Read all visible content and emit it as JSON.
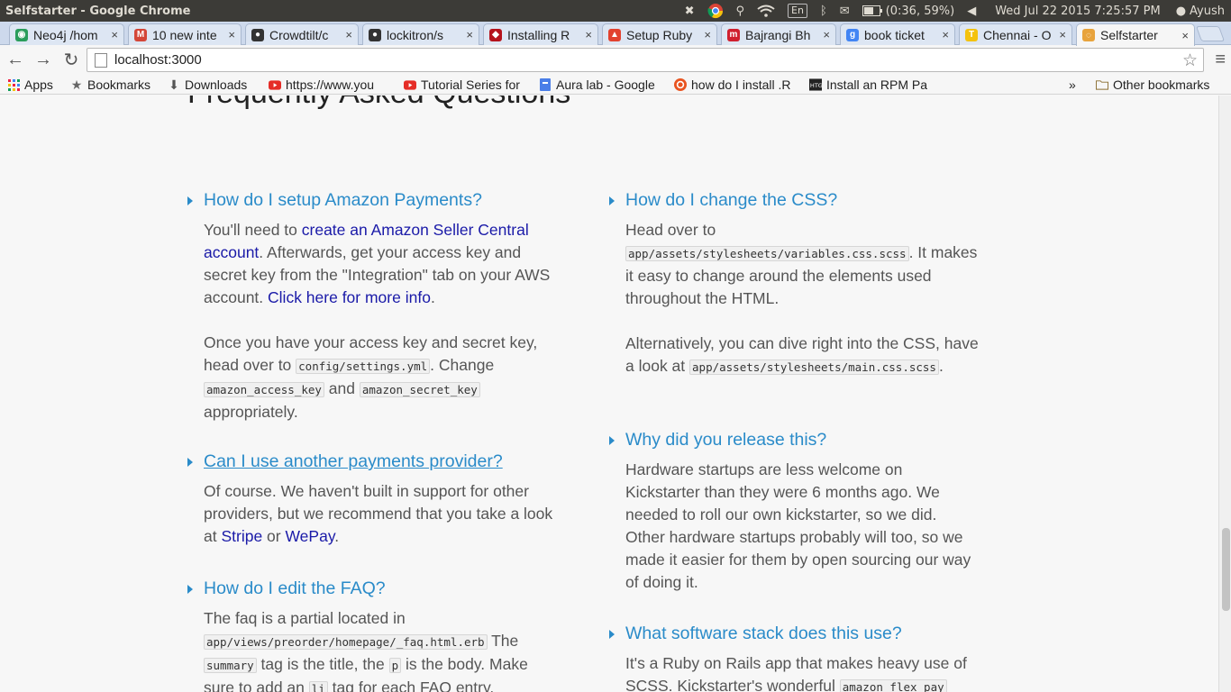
{
  "window": {
    "title": "Selfstarter - Google Chrome"
  },
  "os_panel": {
    "language": "En",
    "battery": "(0:36, 59%)",
    "datetime": "Wed Jul 22 2015  7:25:57 PM",
    "user": "Ayush"
  },
  "tabs": [
    {
      "label": "Neo4j /hom",
      "fav_color": "#2a9d5b",
      "fav_glyph": "◉"
    },
    {
      "label": "10 new inte",
      "fav_color": "#d44638",
      "fav_glyph": "M"
    },
    {
      "label": "Crowdtilt/c",
      "fav_color": "#333333",
      "fav_glyph": "●"
    },
    {
      "label": "lockitron/s",
      "fav_color": "#333333",
      "fav_glyph": "●"
    },
    {
      "label": "Installing R",
      "fav_color": "#b5121b",
      "fav_glyph": "◆"
    },
    {
      "label": "Setup Ruby",
      "fav_color": "#e2422f",
      "fav_glyph": "▲"
    },
    {
      "label": "Bajrangi Bh",
      "fav_color": "#d01f2e",
      "fav_glyph": "m"
    },
    {
      "label": "book ticket",
      "fav_color": "#4285f4",
      "fav_glyph": "g"
    },
    {
      "label": "Chennai - O",
      "fav_color": "#f4c20d",
      "fav_glyph": "T"
    },
    {
      "label": "Selfstarter",
      "fav_color": "#e8a33c",
      "fav_glyph": "◌"
    }
  ],
  "address_bar": {
    "url": "localhost:3000"
  },
  "bookmarks": [
    {
      "label": "Apps",
      "icon": "apps-grid-icon"
    },
    {
      "label": "Bookmarks",
      "icon": "star-icon"
    },
    {
      "label": "Downloads",
      "icon": "download-icon"
    },
    {
      "label": "https://www.you",
      "icon": "youtube-icon"
    },
    {
      "label": "Tutorial Series for",
      "icon": "youtube-icon"
    },
    {
      "label": "Aura lab - Google",
      "icon": "google-sites-icon"
    },
    {
      "label": "how do I install .R",
      "icon": "ubuntu-icon"
    },
    {
      "label": "Install an RPM Pa",
      "icon": "htg-icon"
    }
  ],
  "bookmarks_overflow": "»",
  "other_bookmarks": "Other bookmarks",
  "page": {
    "heading": "Frequently Asked Questions",
    "faq_left": [
      {
        "question": "How do I setup Amazon Payments?",
        "p1_pre": "You'll need to ",
        "p1_link1": "create an Amazon Seller Central account",
        "p1_mid": ". Afterwards, get your access key and secret key from the \"Integration\" tab on your AWS account. ",
        "p1_link2": "Click here for more info",
        "p1_post": ".",
        "p2_pre": "Once you have your access key and secret key, head over to ",
        "p2_code1": "config/settings.yml",
        "p2_mid": ". Change ",
        "p2_code2": "amazon_access_key",
        "p2_and": " and ",
        "p2_code3": "amazon_secret_key",
        "p2_post": " appropriately."
      },
      {
        "question": "Can I use another payments provider?",
        "p1_pre": "Of course. We haven't built in support for other providers, but we recommend that you take a look at ",
        "p1_link1": "Stripe",
        "p1_or": " or ",
        "p1_link2": "WePay",
        "p1_post": "."
      },
      {
        "question": "How do I edit the FAQ?",
        "p1_pre": "The faq is a partial located in ",
        "p1_code1": "app/views/preorder/homepage/_faq.html.erb",
        "p1_mid1": " The ",
        "p1_code2": "summary",
        "p1_mid2": " tag is the title, the ",
        "p1_code3": "p",
        "p1_mid3": " is the body. Make sure to add an ",
        "p1_code4": "li",
        "p1_post": " tag for each FAQ entry."
      }
    ],
    "faq_right": [
      {
        "question": "How do I change the CSS?",
        "p1_pre": "Head over to ",
        "p1_code1": "app/assets/stylesheets/variables.css.scss",
        "p1_post": ". It makes it easy to change around the elements used throughout the HTML.",
        "p2_pre": "Alternatively, you can dive right into the CSS, have a look at ",
        "p2_code1": "app/assets/stylesheets/main.css.scss",
        "p2_post": "."
      },
      {
        "question": "Why did you release this?",
        "p1": "Hardware startups are less welcome on Kickstarter than they were 6 months ago. We needed to roll our own kickstarter, so we did. Other hardware startups probably will too, so we made it easier for them by open sourcing our way of doing it."
      },
      {
        "question": "What software stack does this use?",
        "p1_pre": "It's a Ruby on Rails app that makes heavy use of SCSS. Kickstarter's wonderful ",
        "p1_code1": "amazon_flex_pay"
      }
    ]
  }
}
